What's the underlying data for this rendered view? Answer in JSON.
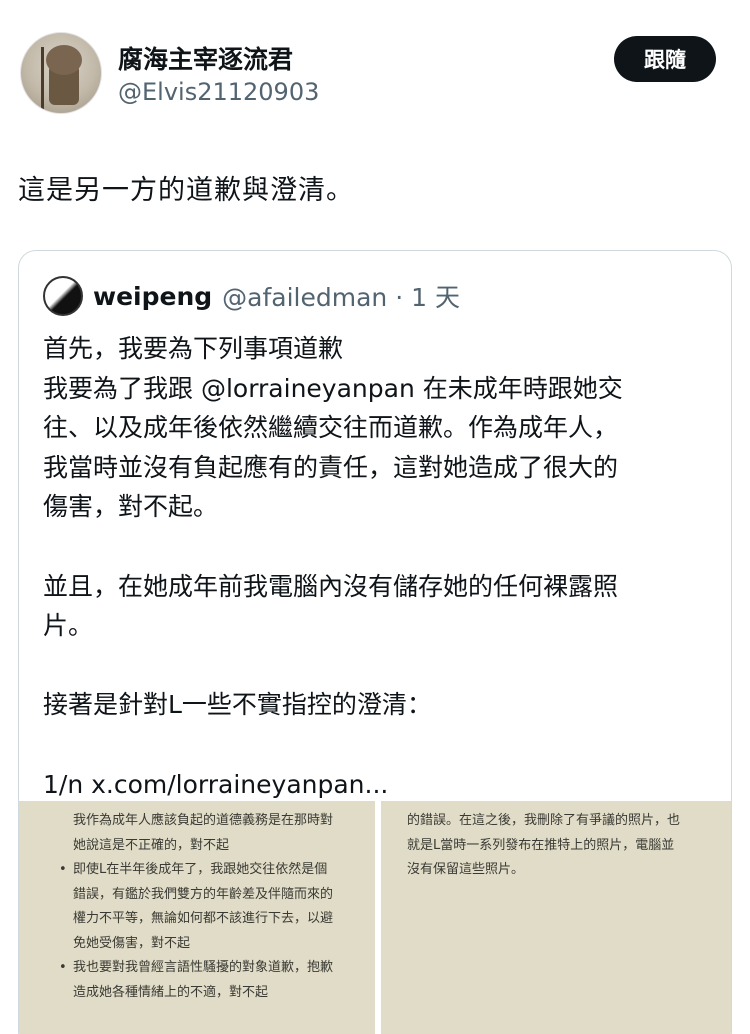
{
  "author": {
    "name": "腐海主宰逐流君",
    "handle": "@Elvis21120903",
    "follow_label": "跟隨"
  },
  "post": {
    "text": "這是另一方的道歉與澄清。"
  },
  "quote": {
    "name": "weipeng",
    "handle_time": "@afailedman · 1 天",
    "lines": [
      "首先，我要為下列事項道歉",
      "我要為了我跟 @lorraineyanpan 在未成年時跟她交",
      "往、以及成年後依然繼續交往而道歉。作為成年人，",
      "我當時並沒有負起應有的責任，這對她造成了很大的",
      "傷害，對不起。",
      "",
      "並且，在她成年前我電腦內沒有儲存她的任何裸露照",
      "片。",
      "",
      "接著是針對L一些不實指控的澄清：",
      "",
      "1/n x.com/lorraineyanpan..."
    ]
  },
  "images": {
    "left_lines": [
      {
        "text": "我作為成年人應該負起的道德義務是在那時對",
        "bullet": false
      },
      {
        "text": "她說這是不正確的，對不起",
        "bullet": false
      },
      {
        "text": "即使L在半年後成年了，我跟她交往依然是個",
        "bullet": true
      },
      {
        "text": "錯誤，有鑑於我們雙方的年齡差及伴隨而來的",
        "bullet": false
      },
      {
        "text": "權力不平等，無論如何都不該進行下去，以避",
        "bullet": false
      },
      {
        "text": "免她受傷害，對不起",
        "bullet": false
      },
      {
        "text": "我也要對我曾經言語性騷擾的對象道歉，抱歉",
        "bullet": true
      },
      {
        "text": "造成她各種情緒上的不適，對不起",
        "bullet": false
      }
    ],
    "right_lines": [
      "的錯誤。在這之後，我刪除了有爭議的照片，也",
      "就是L當時一系列發布在推特上的照片，電腦並",
      "沒有保留這些照片。"
    ]
  }
}
